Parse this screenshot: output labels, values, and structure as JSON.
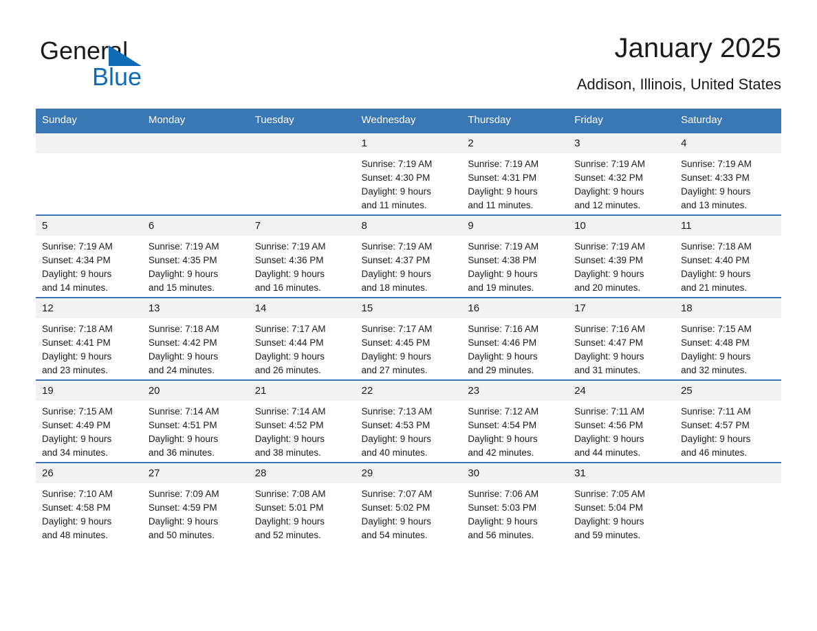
{
  "brand": {
    "name_dark": "General",
    "name_blue": "Blue",
    "accent_color": "#0f6cb4"
  },
  "header": {
    "title": "January 2025",
    "subtitle": "Addison, Illinois, United States"
  },
  "calendar": {
    "header_color": "#3a77b5",
    "date_band_color": "#f2f2f2",
    "weekday_headers": [
      "Sunday",
      "Monday",
      "Tuesday",
      "Wednesday",
      "Thursday",
      "Friday",
      "Saturday"
    ],
    "weeks": [
      [
        {
          "date": "",
          "empty": true
        },
        {
          "date": "",
          "empty": true
        },
        {
          "date": "",
          "empty": true
        },
        {
          "date": "1",
          "sunrise": "Sunrise: 7:19 AM",
          "sunset": "Sunset: 4:30 PM",
          "daylight1": "Daylight: 9 hours",
          "daylight2": "and 11 minutes."
        },
        {
          "date": "2",
          "sunrise": "Sunrise: 7:19 AM",
          "sunset": "Sunset: 4:31 PM",
          "daylight1": "Daylight: 9 hours",
          "daylight2": "and 11 minutes."
        },
        {
          "date": "3",
          "sunrise": "Sunrise: 7:19 AM",
          "sunset": "Sunset: 4:32 PM",
          "daylight1": "Daylight: 9 hours",
          "daylight2": "and 12 minutes."
        },
        {
          "date": "4",
          "sunrise": "Sunrise: 7:19 AM",
          "sunset": "Sunset: 4:33 PM",
          "daylight1": "Daylight: 9 hours",
          "daylight2": "and 13 minutes."
        }
      ],
      [
        {
          "date": "5",
          "sunrise": "Sunrise: 7:19 AM",
          "sunset": "Sunset: 4:34 PM",
          "daylight1": "Daylight: 9 hours",
          "daylight2": "and 14 minutes."
        },
        {
          "date": "6",
          "sunrise": "Sunrise: 7:19 AM",
          "sunset": "Sunset: 4:35 PM",
          "daylight1": "Daylight: 9 hours",
          "daylight2": "and 15 minutes."
        },
        {
          "date": "7",
          "sunrise": "Sunrise: 7:19 AM",
          "sunset": "Sunset: 4:36 PM",
          "daylight1": "Daylight: 9 hours",
          "daylight2": "and 16 minutes."
        },
        {
          "date": "8",
          "sunrise": "Sunrise: 7:19 AM",
          "sunset": "Sunset: 4:37 PM",
          "daylight1": "Daylight: 9 hours",
          "daylight2": "and 18 minutes."
        },
        {
          "date": "9",
          "sunrise": "Sunrise: 7:19 AM",
          "sunset": "Sunset: 4:38 PM",
          "daylight1": "Daylight: 9 hours",
          "daylight2": "and 19 minutes."
        },
        {
          "date": "10",
          "sunrise": "Sunrise: 7:19 AM",
          "sunset": "Sunset: 4:39 PM",
          "daylight1": "Daylight: 9 hours",
          "daylight2": "and 20 minutes."
        },
        {
          "date": "11",
          "sunrise": "Sunrise: 7:18 AM",
          "sunset": "Sunset: 4:40 PM",
          "daylight1": "Daylight: 9 hours",
          "daylight2": "and 21 minutes."
        }
      ],
      [
        {
          "date": "12",
          "sunrise": "Sunrise: 7:18 AM",
          "sunset": "Sunset: 4:41 PM",
          "daylight1": "Daylight: 9 hours",
          "daylight2": "and 23 minutes."
        },
        {
          "date": "13",
          "sunrise": "Sunrise: 7:18 AM",
          "sunset": "Sunset: 4:42 PM",
          "daylight1": "Daylight: 9 hours",
          "daylight2": "and 24 minutes."
        },
        {
          "date": "14",
          "sunrise": "Sunrise: 7:17 AM",
          "sunset": "Sunset: 4:44 PM",
          "daylight1": "Daylight: 9 hours",
          "daylight2": "and 26 minutes."
        },
        {
          "date": "15",
          "sunrise": "Sunrise: 7:17 AM",
          "sunset": "Sunset: 4:45 PM",
          "daylight1": "Daylight: 9 hours",
          "daylight2": "and 27 minutes."
        },
        {
          "date": "16",
          "sunrise": "Sunrise: 7:16 AM",
          "sunset": "Sunset: 4:46 PM",
          "daylight1": "Daylight: 9 hours",
          "daylight2": "and 29 minutes."
        },
        {
          "date": "17",
          "sunrise": "Sunrise: 7:16 AM",
          "sunset": "Sunset: 4:47 PM",
          "daylight1": "Daylight: 9 hours",
          "daylight2": "and 31 minutes."
        },
        {
          "date": "18",
          "sunrise": "Sunrise: 7:15 AM",
          "sunset": "Sunset: 4:48 PM",
          "daylight1": "Daylight: 9 hours",
          "daylight2": "and 32 minutes."
        }
      ],
      [
        {
          "date": "19",
          "sunrise": "Sunrise: 7:15 AM",
          "sunset": "Sunset: 4:49 PM",
          "daylight1": "Daylight: 9 hours",
          "daylight2": "and 34 minutes."
        },
        {
          "date": "20",
          "sunrise": "Sunrise: 7:14 AM",
          "sunset": "Sunset: 4:51 PM",
          "daylight1": "Daylight: 9 hours",
          "daylight2": "and 36 minutes."
        },
        {
          "date": "21",
          "sunrise": "Sunrise: 7:14 AM",
          "sunset": "Sunset: 4:52 PM",
          "daylight1": "Daylight: 9 hours",
          "daylight2": "and 38 minutes."
        },
        {
          "date": "22",
          "sunrise": "Sunrise: 7:13 AM",
          "sunset": "Sunset: 4:53 PM",
          "daylight1": "Daylight: 9 hours",
          "daylight2": "and 40 minutes."
        },
        {
          "date": "23",
          "sunrise": "Sunrise: 7:12 AM",
          "sunset": "Sunset: 4:54 PM",
          "daylight1": "Daylight: 9 hours",
          "daylight2": "and 42 minutes."
        },
        {
          "date": "24",
          "sunrise": "Sunrise: 7:11 AM",
          "sunset": "Sunset: 4:56 PM",
          "daylight1": "Daylight: 9 hours",
          "daylight2": "and 44 minutes."
        },
        {
          "date": "25",
          "sunrise": "Sunrise: 7:11 AM",
          "sunset": "Sunset: 4:57 PM",
          "daylight1": "Daylight: 9 hours",
          "daylight2": "and 46 minutes."
        }
      ],
      [
        {
          "date": "26",
          "sunrise": "Sunrise: 7:10 AM",
          "sunset": "Sunset: 4:58 PM",
          "daylight1": "Daylight: 9 hours",
          "daylight2": "and 48 minutes."
        },
        {
          "date": "27",
          "sunrise": "Sunrise: 7:09 AM",
          "sunset": "Sunset: 4:59 PM",
          "daylight1": "Daylight: 9 hours",
          "daylight2": "and 50 minutes."
        },
        {
          "date": "28",
          "sunrise": "Sunrise: 7:08 AM",
          "sunset": "Sunset: 5:01 PM",
          "daylight1": "Daylight: 9 hours",
          "daylight2": "and 52 minutes."
        },
        {
          "date": "29",
          "sunrise": "Sunrise: 7:07 AM",
          "sunset": "Sunset: 5:02 PM",
          "daylight1": "Daylight: 9 hours",
          "daylight2": "and 54 minutes."
        },
        {
          "date": "30",
          "sunrise": "Sunrise: 7:06 AM",
          "sunset": "Sunset: 5:03 PM",
          "daylight1": "Daylight: 9 hours",
          "daylight2": "and 56 minutes."
        },
        {
          "date": "31",
          "sunrise": "Sunrise: 7:05 AM",
          "sunset": "Sunset: 5:04 PM",
          "daylight1": "Daylight: 9 hours",
          "daylight2": "and 59 minutes."
        },
        {
          "date": "",
          "empty": true
        }
      ]
    ]
  }
}
